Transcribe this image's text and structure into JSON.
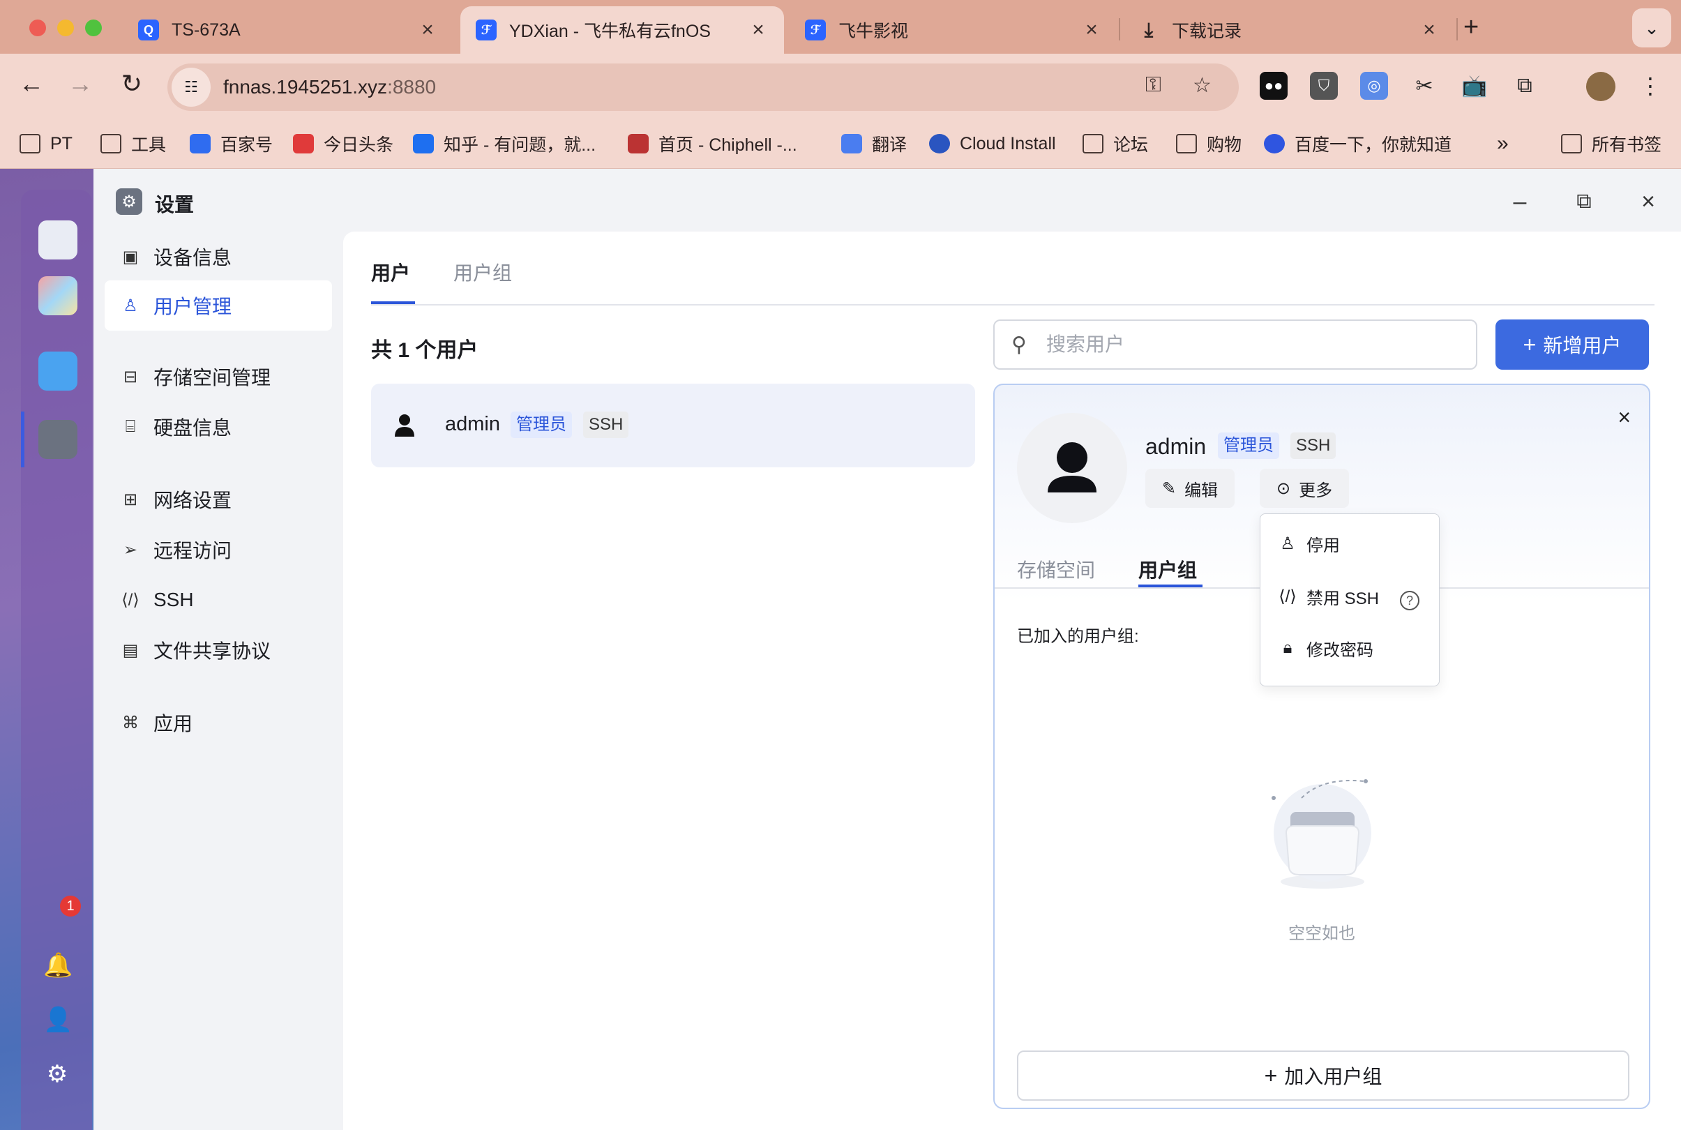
{
  "browser": {
    "tabs": [
      {
        "title": "TS-673A"
      },
      {
        "title": "YDXian - 飞牛私有云fnOS"
      },
      {
        "title": "飞牛影视"
      },
      {
        "title": "下载记录"
      }
    ],
    "url_host": "fnnas.1945251.xyz",
    "url_port": ":8880",
    "bookmarks": [
      {
        "label": "PT"
      },
      {
        "label": "工具"
      },
      {
        "label": "百家号"
      },
      {
        "label": "今日头条"
      },
      {
        "label": "知乎 - 有问题，就..."
      },
      {
        "label": "首页 - Chiphell -..."
      },
      {
        "label": "翻译"
      },
      {
        "label": "Cloud Install"
      },
      {
        "label": "论坛"
      },
      {
        "label": "购物"
      },
      {
        "label": "百度一下，你就知道"
      },
      {
        "label": "所有书签"
      }
    ],
    "bookmarks_overflow": "»"
  },
  "dock": {
    "notification_badge": "1"
  },
  "window": {
    "title": "设置"
  },
  "sidebar": {
    "items": [
      {
        "label": "设备信息"
      },
      {
        "label": "用户管理"
      },
      {
        "label": "存储空间管理"
      },
      {
        "label": "硬盘信息"
      },
      {
        "label": "网络设置"
      },
      {
        "label": "远程访问"
      },
      {
        "label": "SSH"
      },
      {
        "label": "文件共享协议"
      },
      {
        "label": "应用"
      }
    ]
  },
  "content": {
    "tabs": [
      {
        "label": "用户"
      },
      {
        "label": "用户组"
      }
    ],
    "user_count": "共 1 个用户",
    "search_placeholder": "搜索用户",
    "add_user_label": "新增用户",
    "users": [
      {
        "name": "admin",
        "role_badge": "管理员",
        "ssh_badge": "SSH"
      }
    ]
  },
  "detail": {
    "name": "admin",
    "role_badge": "管理员",
    "ssh_badge": "SSH",
    "edit_label": "编辑",
    "more_label": "更多",
    "tabs": [
      {
        "label": "存储空间"
      },
      {
        "label": "用户组"
      }
    ],
    "joined_groups_label": "已加入的用户组:",
    "empty_text": "空空如也",
    "join_group_label": "加入用户组"
  },
  "more_menu": {
    "items": [
      {
        "label": "停用"
      },
      {
        "label": "禁用 SSH"
      },
      {
        "label": "修改密码"
      }
    ]
  },
  "colors": {
    "accent": "#3c6ae0",
    "tab_bar": "#dfa896",
    "toolbar": "#f3d7cf"
  }
}
